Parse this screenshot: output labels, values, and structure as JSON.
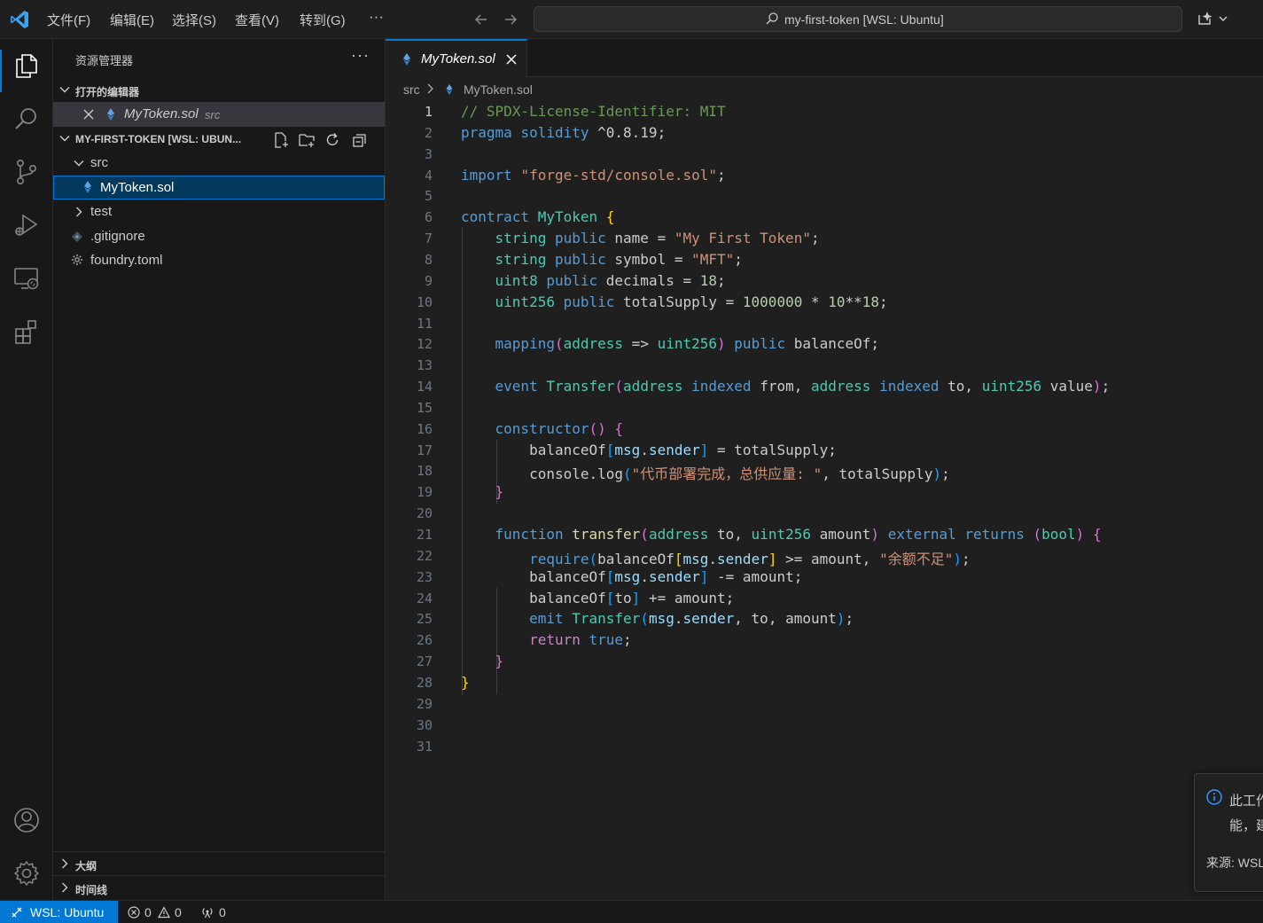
{
  "menu": {
    "items": [
      "文件(F)",
      "编辑(E)",
      "选择(S)",
      "查看(V)",
      "转到(G)",
      "···"
    ]
  },
  "command_center": {
    "text": "my-first-token [WSL: Ubuntu]"
  },
  "sidebar": {
    "title": "资源管理器",
    "more": "···",
    "open_editors": {
      "header": "打开的编辑器",
      "items": [
        {
          "name": "MyToken.sol",
          "folder": "src"
        }
      ]
    },
    "explorer": {
      "header": "MY-FIRST-TOKEN [WSL: UBUN...",
      "tree": [
        {
          "label": "src",
          "type": "folder-open"
        },
        {
          "label": "MyToken.sol",
          "type": "file-sol"
        },
        {
          "label": "test",
          "type": "folder-closed"
        },
        {
          "label": ".gitignore",
          "type": "file-git"
        },
        {
          "label": "foundry.toml",
          "type": "file-config"
        }
      ]
    },
    "outline": {
      "header": "大纲"
    },
    "timeline": {
      "header": "时间线"
    }
  },
  "editor": {
    "tab": {
      "label": "MyToken.sol"
    },
    "breadcrumb": {
      "folder": "src",
      "file": "MyToken.sol"
    },
    "current_line": 1,
    "lines": [
      [
        [
          "c-com",
          "// SPDX-License-Identifier: MIT"
        ]
      ],
      [
        [
          "c-kw",
          "pragma"
        ],
        [
          "c-pl",
          " "
        ],
        [
          "c-kw",
          "solidity"
        ],
        [
          "c-pl",
          " ^0.8.19;"
        ]
      ],
      [],
      [
        [
          "c-kw",
          "import"
        ],
        [
          "c-pl",
          " "
        ],
        [
          "c-str",
          "\"forge-std/console.sol\""
        ],
        [
          "c-pl",
          ";"
        ]
      ],
      [],
      [
        [
          "c-kw",
          "contract"
        ],
        [
          "c-pl",
          " "
        ],
        [
          "c-ty",
          "MyToken"
        ],
        [
          "c-pl",
          " "
        ],
        [
          "c-br1",
          "{"
        ]
      ],
      [
        [
          "c-pl",
          "    "
        ],
        [
          "c-ty",
          "string"
        ],
        [
          "c-pl",
          " "
        ],
        [
          "c-kw",
          "public"
        ],
        [
          "c-pl",
          " name = "
        ],
        [
          "c-str",
          "\"My First Token\""
        ],
        [
          "c-pl",
          ";"
        ]
      ],
      [
        [
          "c-pl",
          "    "
        ],
        [
          "c-ty",
          "string"
        ],
        [
          "c-pl",
          " "
        ],
        [
          "c-kw",
          "public"
        ],
        [
          "c-pl",
          " symbol = "
        ],
        [
          "c-str",
          "\"MFT\""
        ],
        [
          "c-pl",
          ";"
        ]
      ],
      [
        [
          "c-pl",
          "    "
        ],
        [
          "c-ty",
          "uint8"
        ],
        [
          "c-pl",
          " "
        ],
        [
          "c-kw",
          "public"
        ],
        [
          "c-pl",
          " decimals = "
        ],
        [
          "c-num",
          "18"
        ],
        [
          "c-pl",
          ";"
        ]
      ],
      [
        [
          "c-pl",
          "    "
        ],
        [
          "c-ty",
          "uint256"
        ],
        [
          "c-pl",
          " "
        ],
        [
          "c-kw",
          "public"
        ],
        [
          "c-pl",
          " totalSupply = "
        ],
        [
          "c-num",
          "1000000"
        ],
        [
          "c-pl",
          " * "
        ],
        [
          "c-num",
          "10"
        ],
        [
          "c-pl",
          "**"
        ],
        [
          "c-num",
          "18"
        ],
        [
          "c-pl",
          ";"
        ]
      ],
      [],
      [
        [
          "c-pl",
          "    "
        ],
        [
          "c-kw",
          "mapping"
        ],
        [
          "c-br2",
          "("
        ],
        [
          "c-ty",
          "address"
        ],
        [
          "c-pl",
          " => "
        ],
        [
          "c-ty",
          "uint256"
        ],
        [
          "c-br2",
          ")"
        ],
        [
          "c-pl",
          " "
        ],
        [
          "c-kw",
          "public"
        ],
        [
          "c-pl",
          " balanceOf;"
        ]
      ],
      [],
      [
        [
          "c-pl",
          "    "
        ],
        [
          "c-kw",
          "event"
        ],
        [
          "c-pl",
          " "
        ],
        [
          "c-ty",
          "Transfer"
        ],
        [
          "c-br2",
          "("
        ],
        [
          "c-ty",
          "address"
        ],
        [
          "c-pl",
          " "
        ],
        [
          "c-kw",
          "indexed"
        ],
        [
          "c-pl",
          " from, "
        ],
        [
          "c-ty",
          "address"
        ],
        [
          "c-pl",
          " "
        ],
        [
          "c-kw",
          "indexed"
        ],
        [
          "c-pl",
          " to, "
        ],
        [
          "c-ty",
          "uint256"
        ],
        [
          "c-pl",
          " value"
        ],
        [
          "c-br2",
          ")"
        ],
        [
          "c-pl",
          ";"
        ]
      ],
      [],
      [
        [
          "c-pl",
          "    "
        ],
        [
          "c-kw",
          "constructor"
        ],
        [
          "c-br2",
          "()"
        ],
        [
          "c-pl",
          " "
        ],
        [
          "c-br2",
          "{"
        ]
      ],
      [
        [
          "c-pl",
          "        balanceOf"
        ],
        [
          "c-br3",
          "["
        ],
        [
          "c-var",
          "msg"
        ],
        [
          "c-pl",
          "."
        ],
        [
          "c-var",
          "sender"
        ],
        [
          "c-br3",
          "]"
        ],
        [
          "c-pl",
          " = totalSupply;"
        ]
      ],
      [
        [
          "c-pl",
          "        console."
        ],
        [
          "c-pl",
          "log"
        ],
        [
          "c-br3",
          "("
        ],
        [
          "c-str",
          "\"代币部署完成，总供应量: \""
        ],
        [
          "c-pl",
          ", totalSupply"
        ],
        [
          "c-br3",
          ")"
        ],
        [
          "c-pl",
          ";"
        ]
      ],
      [
        [
          "c-pl",
          "    "
        ],
        [
          "c-br2",
          "}"
        ]
      ],
      [],
      [
        [
          "c-pl",
          "    "
        ],
        [
          "c-kw",
          "function"
        ],
        [
          "c-pl",
          " "
        ],
        [
          "c-fn",
          "transfer"
        ],
        [
          "c-br2",
          "("
        ],
        [
          "c-ty",
          "address"
        ],
        [
          "c-pl",
          " to, "
        ],
        [
          "c-ty",
          "uint256"
        ],
        [
          "c-pl",
          " amount"
        ],
        [
          "c-br2",
          ")"
        ],
        [
          "c-pl",
          " "
        ],
        [
          "c-kw",
          "external"
        ],
        [
          "c-pl",
          " "
        ],
        [
          "c-kw",
          "returns"
        ],
        [
          "c-pl",
          " "
        ],
        [
          "c-br2",
          "("
        ],
        [
          "c-ty",
          "bool"
        ],
        [
          "c-br2",
          ")"
        ],
        [
          "c-pl",
          " "
        ],
        [
          "c-br2",
          "{"
        ]
      ],
      [
        [
          "c-pl",
          "        "
        ],
        [
          "c-kw",
          "require"
        ],
        [
          "c-br3",
          "("
        ],
        [
          "c-pl",
          "balanceOf"
        ],
        [
          "c-br1",
          "["
        ],
        [
          "c-var",
          "msg"
        ],
        [
          "c-pl",
          "."
        ],
        [
          "c-var",
          "sender"
        ],
        [
          "c-br1",
          "]"
        ],
        [
          "c-pl",
          " >= amount, "
        ],
        [
          "c-str",
          "\"余额不足\""
        ],
        [
          "c-br3",
          ")"
        ],
        [
          "c-pl",
          ";"
        ]
      ],
      [
        [
          "c-pl",
          "        balanceOf"
        ],
        [
          "c-br3",
          "["
        ],
        [
          "c-var",
          "msg"
        ],
        [
          "c-pl",
          "."
        ],
        [
          "c-var",
          "sender"
        ],
        [
          "c-br3",
          "]"
        ],
        [
          "c-pl",
          " -= amount;"
        ]
      ],
      [
        [
          "c-pl",
          "        balanceOf"
        ],
        [
          "c-br3",
          "["
        ],
        [
          "c-pl",
          "to"
        ],
        [
          "c-br3",
          "]"
        ],
        [
          "c-pl",
          " += amount;"
        ]
      ],
      [
        [
          "c-pl",
          "        "
        ],
        [
          "c-kw",
          "emit"
        ],
        [
          "c-pl",
          " "
        ],
        [
          "c-ty",
          "Transfer"
        ],
        [
          "c-br3",
          "("
        ],
        [
          "c-var",
          "msg"
        ],
        [
          "c-pl",
          "."
        ],
        [
          "c-var",
          "sender"
        ],
        [
          "c-pl",
          ", to, amount"
        ],
        [
          "c-br3",
          ")"
        ],
        [
          "c-pl",
          ";"
        ]
      ],
      [
        [
          "c-pl",
          "        "
        ],
        [
          "c-ctl",
          "return"
        ],
        [
          "c-pl",
          " "
        ],
        [
          "c-kw",
          "true"
        ],
        [
          "c-pl",
          ";"
        ]
      ],
      [
        [
          "c-pl",
          "    "
        ],
        [
          "c-br2",
          "}"
        ]
      ],
      [
        [
          "c-br1",
          "}"
        ]
      ],
      [],
      [],
      []
    ]
  },
  "notification": {
    "line1": "此工作",
    "line2": "能，建",
    "source": "来源: WSL"
  },
  "statusbar": {
    "remote": "WSL: Ubuntu",
    "errors": "0",
    "warnings": "0",
    "ports": "0"
  },
  "colors": {
    "accent": "#0078d4",
    "background": "#1f1f1f",
    "sidebar": "#181818"
  }
}
